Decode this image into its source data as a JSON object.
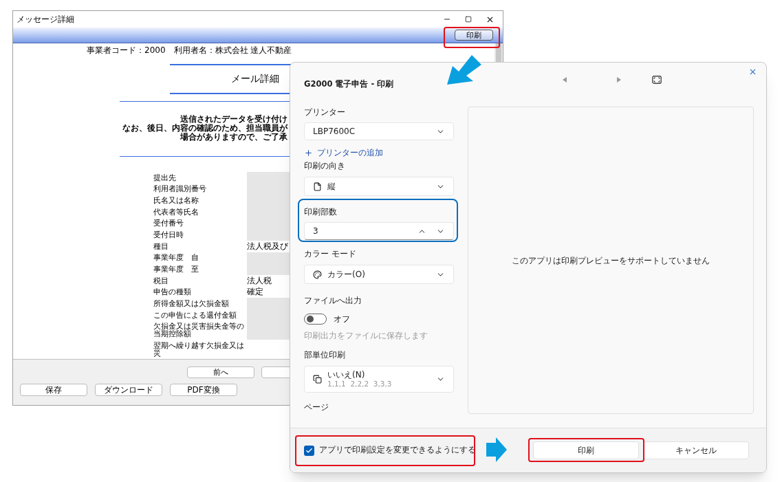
{
  "back_window": {
    "title": "メッセージ詳細",
    "toolbar_button": "印刷",
    "header": "事業者コード：2000　利用者名：株式会社 達人不動産",
    "heading": "メール詳細",
    "message_lines": [
      "送信されたデータを受け付け",
      "なお、後日、内容の確認のため、担当職員が",
      "場合がありますので、ご了承"
    ],
    "fields": [
      {
        "label": "提出先",
        "shaded": true
      },
      {
        "label": "利用者識別番号",
        "shaded": true
      },
      {
        "label": "氏名又は名称",
        "shaded": true
      },
      {
        "label": "代表者等氏名",
        "shaded": true
      },
      {
        "label": "受付番号",
        "shaded": true
      },
      {
        "label": "受付日時",
        "shaded": true
      },
      {
        "label": "種目",
        "value": "法人税及び",
        "shaded": false
      },
      {
        "label": "事業年度　自",
        "shaded": true
      },
      {
        "label": "事業年度　至",
        "shaded": true
      },
      {
        "label": "税目",
        "value": "法人税",
        "shaded": false
      },
      {
        "label": "申告の種類",
        "value": "確定",
        "shaded": false
      },
      {
        "label": "所得金額又は欠損金額",
        "shaded": true
      },
      {
        "label": "この申告による還付金額",
        "shaded": true
      },
      {
        "label": "欠損金又は災害損失金等の当期控除額",
        "shaded": true
      },
      {
        "label": "翌期へ繰り越す欠損金又は災",
        "shaded": false
      }
    ],
    "nav_buttons": [
      "前へ"
    ],
    "action_buttons": [
      "保存",
      "ダウンロード",
      "PDF変換"
    ]
  },
  "print_dialog": {
    "title": "G2000 電子申告 - 印刷",
    "printer_label": "プリンター",
    "printer": "LBP7600C",
    "add_printer": "プリンターの追加",
    "orientation_label": "印刷の向き",
    "orientation": "縦",
    "copies_label": "印刷部数",
    "copies": "3",
    "color_label": "カラー モード",
    "color_mode": "カラー(O)",
    "file_label": "ファイルへ出力",
    "file_output": {
      "on": false,
      "label": "オフ"
    },
    "file_hint": "印刷出力をファイルに保存します",
    "collate_label": "部単位印刷",
    "collate": {
      "value": "いいえ(N)",
      "detail": "1,1,1  2,2,2  3,3,3"
    },
    "page_label": "ページ",
    "preview_message": "このアプリは印刷プレビューをサポートしていません",
    "allow_app_settings": {
      "checked": true,
      "label": "アプリで印刷設定を変更できるようにする"
    },
    "buttons": [
      "印刷",
      "キャンセル"
    ]
  }
}
